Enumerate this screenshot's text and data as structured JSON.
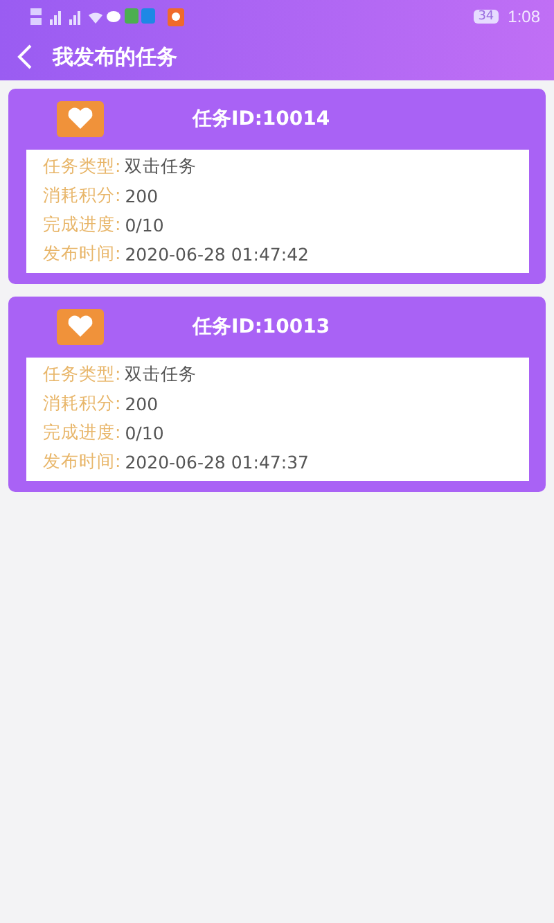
{
  "status_bar": {
    "battery": "34",
    "time": "1:08"
  },
  "header": {
    "title": "我发布的任务"
  },
  "tasks": [
    {
      "title": "任务ID:10014",
      "fields": [
        {
          "label": "任务类型:",
          "value": "双击任务"
        },
        {
          "label": "消耗积分:",
          "value": "200"
        },
        {
          "label": "完成进度:",
          "value": "0/10"
        },
        {
          "label": "发布时间:",
          "value": "2020-06-28 01:47:42"
        }
      ]
    },
    {
      "title": "任务ID:10013",
      "fields": [
        {
          "label": "任务类型:",
          "value": "双击任务"
        },
        {
          "label": "消耗积分:",
          "value": "200"
        },
        {
          "label": "完成进度:",
          "value": "0/10"
        },
        {
          "label": "发布时间:",
          "value": "2020-06-28 01:47:37"
        }
      ]
    }
  ]
}
